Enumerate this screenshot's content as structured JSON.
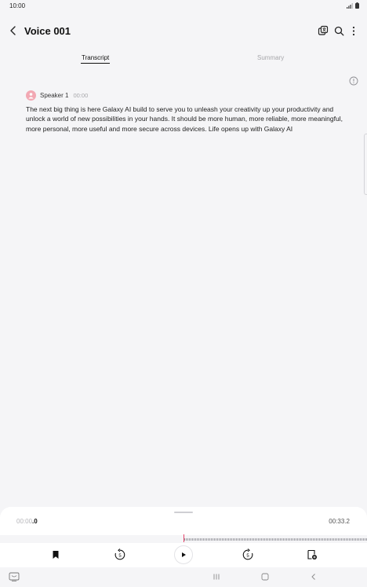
{
  "status_bar": {
    "time": "10:00",
    "indicators": "signal-icon battery-icon"
  },
  "app_bar": {
    "title": "Voice 001",
    "actions": [
      "translate-icon",
      "search-icon",
      "more-options-icon"
    ]
  },
  "tabs": [
    {
      "label": "Transcript",
      "selected": true
    },
    {
      "label": "Summary",
      "selected": false
    }
  ],
  "transcript": {
    "segments": [
      {
        "speaker": "Speaker 1",
        "timestamp": "00:00",
        "text": "The next big thing is here Galaxy AI build to serve you to unleash your creativity up your productivity and unlock a world of new possibilities in your hands. It should be more human, more reliable, more meaningful, more personal, more useful and more secure across devices. Life opens up with Galaxy AI"
      }
    ]
  },
  "player": {
    "current_time_main": "00:00",
    "current_time_fraction": ".0",
    "total_time": "00:33.2",
    "playback_progress": 0.0,
    "controls": [
      "bookmark-icon",
      "rewind-5-icon",
      "play-icon",
      "forward-5-icon",
      "add-note-icon"
    ],
    "skip_seconds": "5"
  },
  "colors": {
    "background": "#f5f5f7",
    "accent_playhead": "#e7466c",
    "speaker_avatar": "#f2a8b3",
    "inactive_tab": "#a7a7ab"
  }
}
